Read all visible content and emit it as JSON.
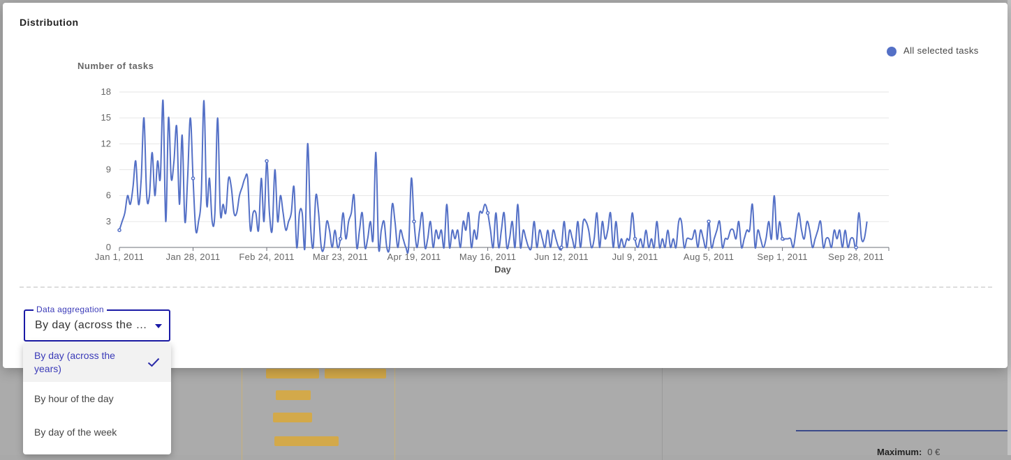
{
  "modal": {
    "title": "Distribution"
  },
  "chart_data": {
    "type": "line",
    "ylabel": "Number of tasks",
    "xlabel": "Day",
    "ylim": [
      0,
      18
    ],
    "y_ticks": [
      0,
      3,
      6,
      9,
      12,
      15,
      18
    ],
    "x_ticks": [
      "Jan 1, 2011",
      "Jan 28, 2011",
      "Feb 24, 2011",
      "Mar 23, 2011",
      "Apr 19, 2011",
      "May 16, 2011",
      "Jun 12, 2011",
      "Jul 9, 2011",
      "Aug 5, 2011",
      "Sep 1, 2011",
      "Sep 28, 2011"
    ],
    "x_range": [
      "2011-01-01",
      "2011-10-10"
    ],
    "grid": true,
    "legend_position": "top-right",
    "series": [
      {
        "name": "All selected tasks",
        "color": "#5470c6",
        "points": [
          [
            "2011-01-01",
            2
          ],
          [
            "2011-01-02",
            3
          ],
          [
            "2011-01-03",
            4
          ],
          [
            "2011-01-04",
            6
          ],
          [
            "2011-01-05",
            5
          ],
          [
            "2011-01-06",
            7
          ],
          [
            "2011-01-07",
            10
          ],
          [
            "2011-01-08",
            5
          ],
          [
            "2011-01-09",
            8
          ],
          [
            "2011-01-10",
            15
          ],
          [
            "2011-01-11",
            6
          ],
          [
            "2011-01-12",
            6
          ],
          [
            "2011-01-13",
            11
          ],
          [
            "2011-01-14",
            6
          ],
          [
            "2011-01-15",
            10
          ],
          [
            "2011-01-16",
            8
          ],
          [
            "2011-01-17",
            17
          ],
          [
            "2011-01-18",
            3
          ],
          [
            "2011-01-19",
            15
          ],
          [
            "2011-01-20",
            8
          ],
          [
            "2011-01-21",
            10
          ],
          [
            "2011-01-22",
            14
          ],
          [
            "2011-01-23",
            5
          ],
          [
            "2011-01-24",
            13
          ],
          [
            "2011-01-25",
            3
          ],
          [
            "2011-01-26",
            8
          ],
          [
            "2011-01-27",
            15
          ],
          [
            "2011-01-28",
            8
          ],
          [
            "2011-01-29",
            2
          ],
          [
            "2011-01-30",
            3
          ],
          [
            "2011-01-31",
            6
          ],
          [
            "2011-02-01",
            17
          ],
          [
            "2011-02-02",
            5
          ],
          [
            "2011-02-03",
            8
          ],
          [
            "2011-02-04",
            3
          ],
          [
            "2011-02-05",
            4
          ],
          [
            "2011-02-06",
            15
          ],
          [
            "2011-02-07",
            4
          ],
          [
            "2011-02-08",
            5
          ],
          [
            "2011-02-09",
            4
          ],
          [
            "2011-02-10",
            8
          ],
          [
            "2011-02-11",
            7
          ],
          [
            "2011-02-12",
            4
          ],
          [
            "2011-02-13",
            4
          ],
          [
            "2011-02-14",
            6
          ],
          [
            "2011-02-15",
            7
          ],
          [
            "2011-02-16",
            8
          ],
          [
            "2011-02-17",
            8
          ],
          [
            "2011-02-18",
            2
          ],
          [
            "2011-02-19",
            4
          ],
          [
            "2011-02-20",
            4
          ],
          [
            "2011-02-21",
            2
          ],
          [
            "2011-02-22",
            8
          ],
          [
            "2011-02-23",
            3
          ],
          [
            "2011-02-24",
            10
          ],
          [
            "2011-02-25",
            4
          ],
          [
            "2011-02-26",
            2
          ],
          [
            "2011-02-27",
            9
          ],
          [
            "2011-02-28",
            3
          ],
          [
            "2011-03-01",
            6
          ],
          [
            "2011-03-02",
            4
          ],
          [
            "2011-03-03",
            2
          ],
          [
            "2011-03-04",
            3
          ],
          [
            "2011-03-05",
            4
          ],
          [
            "2011-03-06",
            7
          ],
          [
            "2011-03-07",
            0
          ],
          [
            "2011-03-08",
            4
          ],
          [
            "2011-03-09",
            4
          ],
          [
            "2011-03-10",
            0
          ],
          [
            "2011-03-11",
            12
          ],
          [
            "2011-03-12",
            3
          ],
          [
            "2011-03-13",
            0
          ],
          [
            "2011-03-14",
            6
          ],
          [
            "2011-03-15",
            4
          ],
          [
            "2011-03-16",
            0
          ],
          [
            "2011-03-17",
            0
          ],
          [
            "2011-03-18",
            3
          ],
          [
            "2011-03-19",
            2
          ],
          [
            "2011-03-20",
            0
          ],
          [
            "2011-03-21",
            2
          ],
          [
            "2011-03-22",
            0
          ],
          [
            "2011-03-23",
            1
          ],
          [
            "2011-03-24",
            4
          ],
          [
            "2011-03-25",
            1
          ],
          [
            "2011-03-26",
            3
          ],
          [
            "2011-03-27",
            4
          ],
          [
            "2011-03-28",
            6
          ],
          [
            "2011-03-29",
            0
          ],
          [
            "2011-03-30",
            2
          ],
          [
            "2011-03-31",
            4
          ],
          [
            "2011-04-01",
            0
          ],
          [
            "2011-04-02",
            1
          ],
          [
            "2011-04-03",
            3
          ],
          [
            "2011-04-04",
            1
          ],
          [
            "2011-04-05",
            11
          ],
          [
            "2011-04-06",
            0
          ],
          [
            "2011-04-07",
            2
          ],
          [
            "2011-04-08",
            3
          ],
          [
            "2011-04-09",
            0
          ],
          [
            "2011-04-10",
            0
          ],
          [
            "2011-04-11",
            5
          ],
          [
            "2011-04-12",
            3
          ],
          [
            "2011-04-13",
            0
          ],
          [
            "2011-04-14",
            2
          ],
          [
            "2011-04-15",
            1
          ],
          [
            "2011-04-16",
            0
          ],
          [
            "2011-04-17",
            0
          ],
          [
            "2011-04-18",
            8
          ],
          [
            "2011-04-19",
            3
          ],
          [
            "2011-04-20",
            0
          ],
          [
            "2011-04-21",
            2
          ],
          [
            "2011-04-22",
            4
          ],
          [
            "2011-04-23",
            0
          ],
          [
            "2011-04-24",
            1
          ],
          [
            "2011-04-25",
            3
          ],
          [
            "2011-04-26",
            0
          ],
          [
            "2011-04-27",
            2
          ],
          [
            "2011-04-28",
            1
          ],
          [
            "2011-04-29",
            2
          ],
          [
            "2011-04-30",
            0
          ],
          [
            "2011-05-01",
            5
          ],
          [
            "2011-05-02",
            0
          ],
          [
            "2011-05-03",
            2
          ],
          [
            "2011-05-04",
            1
          ],
          [
            "2011-05-05",
            2
          ],
          [
            "2011-05-06",
            0
          ],
          [
            "2011-05-07",
            3
          ],
          [
            "2011-05-08",
            2
          ],
          [
            "2011-05-09",
            4
          ],
          [
            "2011-05-10",
            0
          ],
          [
            "2011-05-11",
            2
          ],
          [
            "2011-05-12",
            1
          ],
          [
            "2011-05-13",
            4
          ],
          [
            "2011-05-14",
            4
          ],
          [
            "2011-05-15",
            5
          ],
          [
            "2011-05-16",
            4
          ],
          [
            "2011-05-17",
            2
          ],
          [
            "2011-05-18",
            0
          ],
          [
            "2011-05-19",
            4
          ],
          [
            "2011-05-20",
            0
          ],
          [
            "2011-05-21",
            2
          ],
          [
            "2011-05-22",
            4
          ],
          [
            "2011-05-23",
            0
          ],
          [
            "2011-05-24",
            1
          ],
          [
            "2011-05-25",
            3
          ],
          [
            "2011-05-26",
            0
          ],
          [
            "2011-05-27",
            5
          ],
          [
            "2011-05-28",
            0
          ],
          [
            "2011-05-29",
            2
          ],
          [
            "2011-05-30",
            1
          ],
          [
            "2011-05-31",
            0
          ],
          [
            "2011-06-01",
            0
          ],
          [
            "2011-06-02",
            3
          ],
          [
            "2011-06-03",
            0
          ],
          [
            "2011-06-04",
            2
          ],
          [
            "2011-06-05",
            1
          ],
          [
            "2011-06-06",
            0
          ],
          [
            "2011-06-07",
            2
          ],
          [
            "2011-06-08",
            0
          ],
          [
            "2011-06-09",
            2
          ],
          [
            "2011-06-10",
            1
          ],
          [
            "2011-06-11",
            0
          ],
          [
            "2011-06-12",
            0
          ],
          [
            "2011-06-13",
            3
          ],
          [
            "2011-06-14",
            0
          ],
          [
            "2011-06-15",
            2
          ],
          [
            "2011-06-16",
            1
          ],
          [
            "2011-06-17",
            0
          ],
          [
            "2011-06-18",
            3
          ],
          [
            "2011-06-19",
            0
          ],
          [
            "2011-06-20",
            3
          ],
          [
            "2011-06-21",
            3
          ],
          [
            "2011-06-22",
            2
          ],
          [
            "2011-06-23",
            0
          ],
          [
            "2011-06-24",
            1
          ],
          [
            "2011-06-25",
            4
          ],
          [
            "2011-06-26",
            0
          ],
          [
            "2011-06-27",
            3
          ],
          [
            "2011-06-28",
            1
          ],
          [
            "2011-06-29",
            2
          ],
          [
            "2011-06-30",
            4
          ],
          [
            "2011-07-01",
            0
          ],
          [
            "2011-07-02",
            3
          ],
          [
            "2011-07-03",
            0
          ],
          [
            "2011-07-04",
            1
          ],
          [
            "2011-07-05",
            0
          ],
          [
            "2011-07-06",
            1
          ],
          [
            "2011-07-07",
            1
          ],
          [
            "2011-07-08",
            4
          ],
          [
            "2011-07-09",
            1
          ],
          [
            "2011-07-10",
            0
          ],
          [
            "2011-07-11",
            1
          ],
          [
            "2011-07-12",
            0
          ],
          [
            "2011-07-13",
            2
          ],
          [
            "2011-07-14",
            0
          ],
          [
            "2011-07-15",
            1
          ],
          [
            "2011-07-16",
            0
          ],
          [
            "2011-07-17",
            3
          ],
          [
            "2011-07-18",
            0
          ],
          [
            "2011-07-19",
            1
          ],
          [
            "2011-07-20",
            0
          ],
          [
            "2011-07-21",
            2
          ],
          [
            "2011-07-22",
            0
          ],
          [
            "2011-07-23",
            1
          ],
          [
            "2011-07-24",
            0
          ],
          [
            "2011-07-25",
            3
          ],
          [
            "2011-07-26",
            3
          ],
          [
            "2011-07-27",
            0
          ],
          [
            "2011-07-28",
            1
          ],
          [
            "2011-07-29",
            1
          ],
          [
            "2011-07-30",
            1
          ],
          [
            "2011-07-31",
            2
          ],
          [
            "2011-08-01",
            0
          ],
          [
            "2011-08-02",
            2
          ],
          [
            "2011-08-03",
            1
          ],
          [
            "2011-08-04",
            0
          ],
          [
            "2011-08-05",
            3
          ],
          [
            "2011-08-06",
            0
          ],
          [
            "2011-08-07",
            1
          ],
          [
            "2011-08-08",
            2
          ],
          [
            "2011-08-09",
            3
          ],
          [
            "2011-08-10",
            0
          ],
          [
            "2011-08-11",
            1
          ],
          [
            "2011-08-12",
            1
          ],
          [
            "2011-08-13",
            2
          ],
          [
            "2011-08-14",
            2
          ],
          [
            "2011-08-15",
            1
          ],
          [
            "2011-08-16",
            3
          ],
          [
            "2011-08-17",
            0
          ],
          [
            "2011-08-18",
            1
          ],
          [
            "2011-08-19",
            2
          ],
          [
            "2011-08-20",
            2
          ],
          [
            "2011-08-21",
            5
          ],
          [
            "2011-08-22",
            0
          ],
          [
            "2011-08-23",
            2
          ],
          [
            "2011-08-24",
            1
          ],
          [
            "2011-08-25",
            0
          ],
          [
            "2011-08-26",
            1
          ],
          [
            "2011-08-27",
            3
          ],
          [
            "2011-08-28",
            1
          ],
          [
            "2011-08-29",
            6
          ],
          [
            "2011-08-30",
            1
          ],
          [
            "2011-08-31",
            3
          ],
          [
            "2011-09-01",
            1
          ],
          [
            "2011-09-02",
            1
          ],
          [
            "2011-09-03",
            1
          ],
          [
            "2011-09-04",
            1
          ],
          [
            "2011-09-05",
            0
          ],
          [
            "2011-09-06",
            2
          ],
          [
            "2011-09-07",
            4
          ],
          [
            "2011-09-08",
            2
          ],
          [
            "2011-09-09",
            1
          ],
          [
            "2011-09-10",
            3
          ],
          [
            "2011-09-11",
            2
          ],
          [
            "2011-09-12",
            0
          ],
          [
            "2011-09-13",
            1
          ],
          [
            "2011-09-14",
            2
          ],
          [
            "2011-09-15",
            3
          ],
          [
            "2011-09-16",
            0
          ],
          [
            "2011-09-17",
            1
          ],
          [
            "2011-09-18",
            1
          ],
          [
            "2011-09-19",
            0
          ],
          [
            "2011-09-20",
            2
          ],
          [
            "2011-09-21",
            1
          ],
          [
            "2011-09-22",
            2
          ],
          [
            "2011-09-23",
            0
          ],
          [
            "2011-09-24",
            2
          ],
          [
            "2011-09-25",
            0
          ],
          [
            "2011-09-26",
            1
          ],
          [
            "2011-09-27",
            1
          ],
          [
            "2011-09-28",
            0
          ],
          [
            "2011-09-29",
            4
          ],
          [
            "2011-09-30",
            1
          ],
          [
            "2011-10-01",
            1
          ],
          [
            "2011-10-02",
            3
          ]
        ]
      }
    ]
  },
  "aggregation": {
    "label": "Data aggregation",
    "selected": "By day (across the years)",
    "options": [
      {
        "label": "By day (across the years)",
        "selected": true
      },
      {
        "label": "By hour of the day",
        "selected": false
      },
      {
        "label": "By day of the week",
        "selected": false
      }
    ]
  },
  "background": {
    "maximum_label": "Maximum:",
    "maximum_value": "0 €"
  },
  "icons": {
    "dropdown": "caret-down-icon",
    "selected": "check-icon",
    "legend": "circle-marker-icon"
  }
}
